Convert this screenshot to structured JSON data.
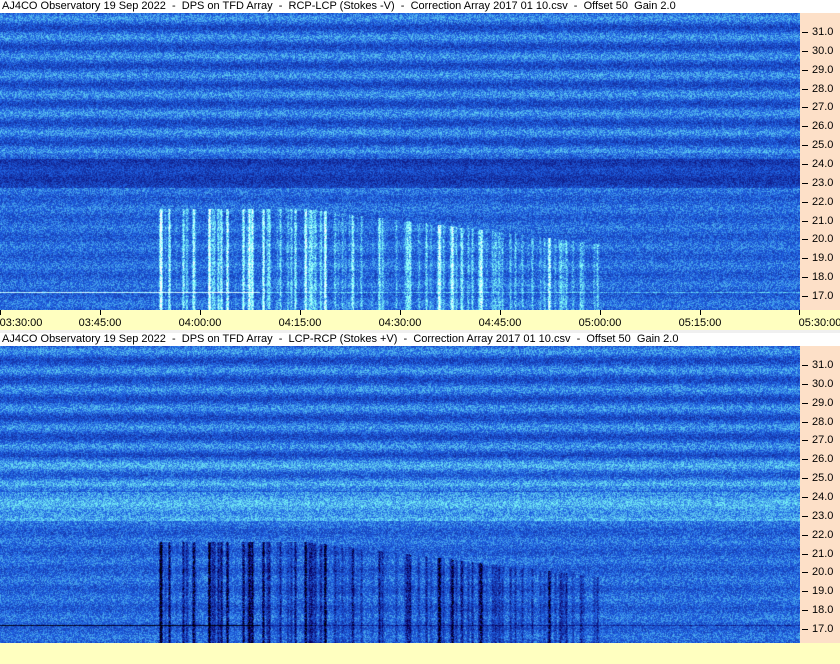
{
  "panels": [
    {
      "title": "AJ4CO Observatory 19 Sep 2022  -  DPS on TFD Array  -  RCP-LCP (Stokes -V)  -  Correction Array 2017 01 10.csv  -  Offset 50  Gain 2.0",
      "polarity": "negative"
    },
    {
      "title": "AJ4CO Observatory 19 Sep 2022  -  DPS on TFD Array  -  LCP-RCP (Stokes +V)  -  Correction Array 2017 01 10.csv  -  Offset 50  Gain 2.0",
      "polarity": "positive"
    }
  ],
  "y_ticks": [
    "31.0",
    "30.0",
    "29.0",
    "28.0",
    "27.0",
    "26.0",
    "25.0",
    "24.0",
    "23.0",
    "22.0",
    "21.0",
    "20.0",
    "19.0",
    "18.0",
    "17.0"
  ],
  "x_ticks": [
    "03:30:00",
    "03:45:00",
    "04:00:00",
    "04:15:00",
    "04:30:00",
    "04:45:00",
    "05:00:00",
    "05:15:00",
    "05:30:00"
  ],
  "colors": {
    "axis_bg": "#fde0c8",
    "time_bg": "#ffffc0",
    "base": "#1e5fe0"
  }
}
